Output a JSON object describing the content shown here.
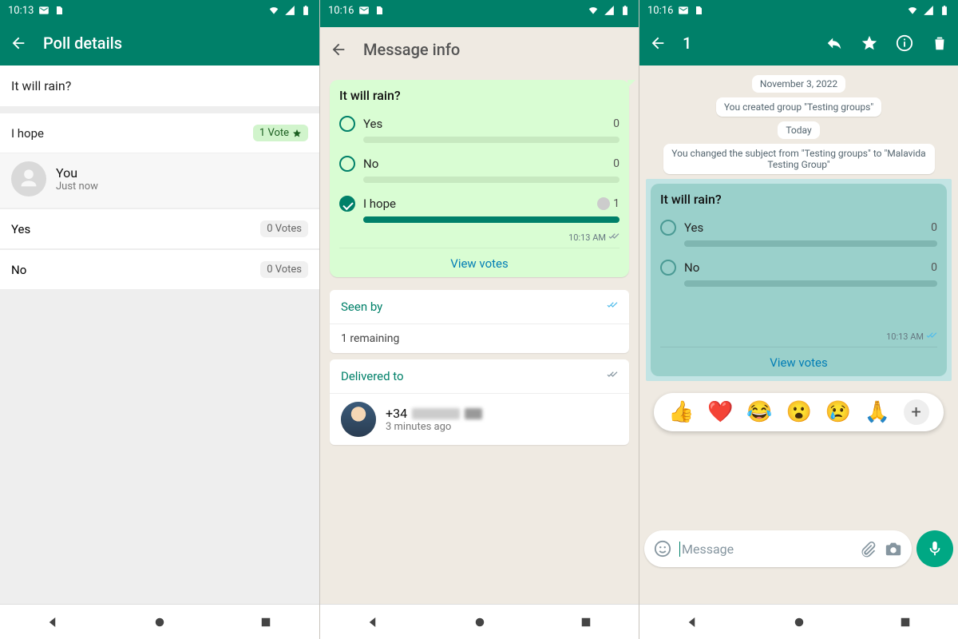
{
  "colors": {
    "primary": "#008069",
    "accent": "#00a884",
    "link": "#027eb5"
  },
  "screen1": {
    "status_time": "10:13",
    "title": "Poll details",
    "question": "It will rain?",
    "highlight": {
      "label": "I hope",
      "badge": "1 Vote"
    },
    "voter": {
      "name": "You",
      "when": "Just now"
    },
    "rows": [
      {
        "label": "Yes",
        "votes": "0 Votes"
      },
      {
        "label": "No",
        "votes": "0 Votes"
      }
    ]
  },
  "screen2": {
    "status_time": "10:16",
    "title": "Message info",
    "poll": {
      "question": "It will rain?",
      "options": [
        {
          "label": "Yes",
          "count": "0",
          "checked": false,
          "fill": 0
        },
        {
          "label": "No",
          "count": "0",
          "checked": false,
          "fill": 0
        },
        {
          "label": "I hope",
          "count": "1",
          "checked": true,
          "fill": 100,
          "avatar": true
        }
      ],
      "time": "10:13 AM",
      "view_votes": "View votes"
    },
    "seen": {
      "title": "Seen by",
      "body": "1 remaining"
    },
    "delivered": {
      "title": "Delivered to",
      "phone_prefix": "+34",
      "when": "3 minutes ago"
    }
  },
  "screen3": {
    "status_time": "10:16",
    "count": "1",
    "date": "November 3, 2022",
    "sys1": "You created group \"Testing groups\"",
    "today": "Today",
    "sys2": "You changed the subject from \"Testing groups\" to \"Malavida Testing Group\"",
    "poll": {
      "question": "It will rain?",
      "options": [
        {
          "label": "Yes",
          "count": "0"
        },
        {
          "label": "No",
          "count": "0"
        }
      ],
      "time": "10:13 AM",
      "view_votes": "View votes"
    },
    "reactions": [
      "👍",
      "❤️",
      "😂",
      "😮",
      "😢",
      "🙏"
    ],
    "composer_placeholder": "Message"
  }
}
